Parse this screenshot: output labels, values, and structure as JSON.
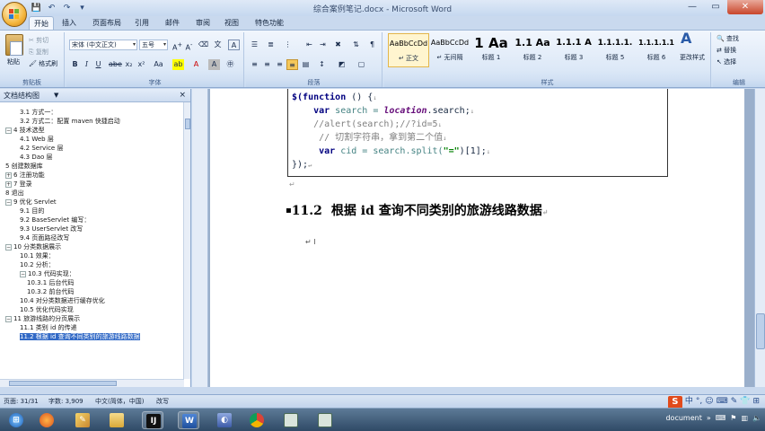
{
  "window": {
    "title": "综合案例笔记.docx - Microsoft Word",
    "controls": [
      "—",
      "▭",
      "✕"
    ]
  },
  "ribbon_tabs": [
    "开始",
    "插入",
    "页面布局",
    "引用",
    "邮件",
    "审阅",
    "视图",
    "特色功能"
  ],
  "clipboard": {
    "paste": "粘贴",
    "cut": "剪切",
    "copy": "复制",
    "format_painter": "格式刷",
    "group_label": "剪贴板"
  },
  "font": {
    "name": "宋体 (中文正文)",
    "size": "五号",
    "group_label": "字体"
  },
  "paragraph": {
    "group_label": "段落"
  },
  "styles": {
    "group_label": "样式",
    "items": [
      {
        "preview": "AaBbCcDd",
        "name": "↵ 正文"
      },
      {
        "preview": "AaBbCcDd",
        "name": "↵ 无间隔"
      },
      {
        "preview": "1 Aa",
        "name": "标题 1"
      },
      {
        "preview": "1.1 Aa",
        "name": "标题 2"
      },
      {
        "preview": "1.1.1 A",
        "name": "标题 3"
      },
      {
        "preview": "1.1.1.1.",
        "name": "标题 5"
      },
      {
        "preview": "1.1.1.1.1",
        "name": "标题 6"
      }
    ],
    "change_styles": "更改样式"
  },
  "editing": {
    "find": "查找",
    "replace": "替换",
    "select": "选择",
    "group_label": "编辑"
  },
  "docmap": {
    "title": "文档结构图",
    "items": [
      {
        "text": "3.1   方式一：",
        "level": 3,
        "toggle": ""
      },
      {
        "text": "3.2 方式二：配置 maven 快捷启动",
        "level": 3,
        "toggle": ""
      },
      {
        "text": "4 技术选型",
        "level": 1,
        "toggle": "−"
      },
      {
        "text": "4.1 Web 层",
        "level": 2,
        "toggle": ""
      },
      {
        "text": "4.2 Service 层",
        "level": 2,
        "toggle": ""
      },
      {
        "text": "4.3 Dao 层",
        "level": 2,
        "toggle": ""
      },
      {
        "text": "5 创建数据库",
        "level": 1,
        "toggle": ""
      },
      {
        "text": "6 注册功能",
        "level": 1,
        "toggle": "+"
      },
      {
        "text": "7 登录",
        "level": 1,
        "toggle": "+"
      },
      {
        "text": "8 退出",
        "level": 1,
        "toggle": ""
      },
      {
        "text": "9 优化 Servlet",
        "level": 1,
        "toggle": "−"
      },
      {
        "text": "9.1 目的",
        "level": 2,
        "toggle": ""
      },
      {
        "text": "9.2 BaseServlet 编写：",
        "level": 2,
        "toggle": ""
      },
      {
        "text": "9.3 UserServlet 改写",
        "level": 2,
        "toggle": ""
      },
      {
        "text": "9.4 页面路径改写",
        "level": 2,
        "toggle": ""
      },
      {
        "text": "10 分类数据展示",
        "level": 1,
        "toggle": "−"
      },
      {
        "text": "10.1 效果：",
        "level": 2,
        "toggle": ""
      },
      {
        "text": "10.2     分析：",
        "level": 2,
        "toggle": ""
      },
      {
        "text": "10.3 代码实现：",
        "level": 2,
        "toggle": "−"
      },
      {
        "text": "10.3.1 后台代码",
        "level": 3,
        "toggle": ""
      },
      {
        "text": "10.3.2 前台代码",
        "level": 3,
        "toggle": ""
      },
      {
        "text": "10.4 对分类数据进行缓存优化",
        "level": 2,
        "toggle": ""
      },
      {
        "text": "10.5 优化代码实现",
        "level": 2,
        "toggle": ""
      },
      {
        "text": "11 旅游线路的分页展示",
        "level": 1,
        "toggle": "−"
      },
      {
        "text": "11.1 类别 id 的传递",
        "level": 2,
        "toggle": ""
      },
      {
        "text": "11.2 根据 id 查询不同类别的旅游线路数据",
        "level": 2,
        "toggle": "",
        "selected": true
      }
    ]
  },
  "document": {
    "code_lines": [
      [
        {
          "t": "$(",
          "c": "kw"
        },
        {
          "t": "function",
          "c": "kw"
        },
        {
          "t": " () {",
          "c": ""
        },
        {
          "t": "↓",
          "c": "mk"
        }
      ],
      [
        {
          "t": "    ",
          "c": ""
        },
        {
          "t": "var",
          "c": "kw"
        },
        {
          "t": " search = ",
          "c": "var"
        },
        {
          "t": "location",
          "c": "obj"
        },
        {
          "t": ".search;",
          "c": ""
        },
        {
          "t": "↓",
          "c": "mk"
        }
      ],
      [
        {
          "t": "    //alert(search);//?id=5",
          "c": "cm"
        },
        {
          "t": "↓",
          "c": "mk"
        }
      ],
      [
        {
          "t": "     // 切割字符串，拿到第二个值",
          "c": "cm"
        },
        {
          "t": "↓",
          "c": "mk"
        }
      ],
      [
        {
          "t": "     ",
          "c": ""
        },
        {
          "t": "var",
          "c": "kw"
        },
        {
          "t": " cid = search.split(",
          "c": "var"
        },
        {
          "t": "\"=\"",
          "c": "str"
        },
        {
          "t": ")[1];",
          "c": ""
        },
        {
          "t": "↓",
          "c": "mk"
        }
      ],
      [
        {
          "t": "});",
          "c": ""
        },
        {
          "t": "↵",
          "c": "mk"
        }
      ]
    ],
    "heading_number": "11.2",
    "heading_text": "根据 id 查询不同类别的旅游线路数据"
  },
  "status": {
    "page": "页面: 31/31",
    "words": "字数: 3,909",
    "language": "中文(简体，中国)",
    "mode": "改写"
  },
  "ime": [
    "中",
    "°,",
    "☺",
    "⌨",
    "✎",
    "👕",
    "⊞"
  ],
  "taskbar": {
    "tray_text": "document",
    "icons": [
      "start-orb",
      "firefox",
      "paint",
      "folder",
      "intellij",
      "word",
      "eclipse",
      "chrome",
      "app-window-1",
      "app-window-2"
    ]
  },
  "colors": {
    "ribbon": "#dce8f7",
    "selection": "#3169c6",
    "close": "#c8452a"
  }
}
